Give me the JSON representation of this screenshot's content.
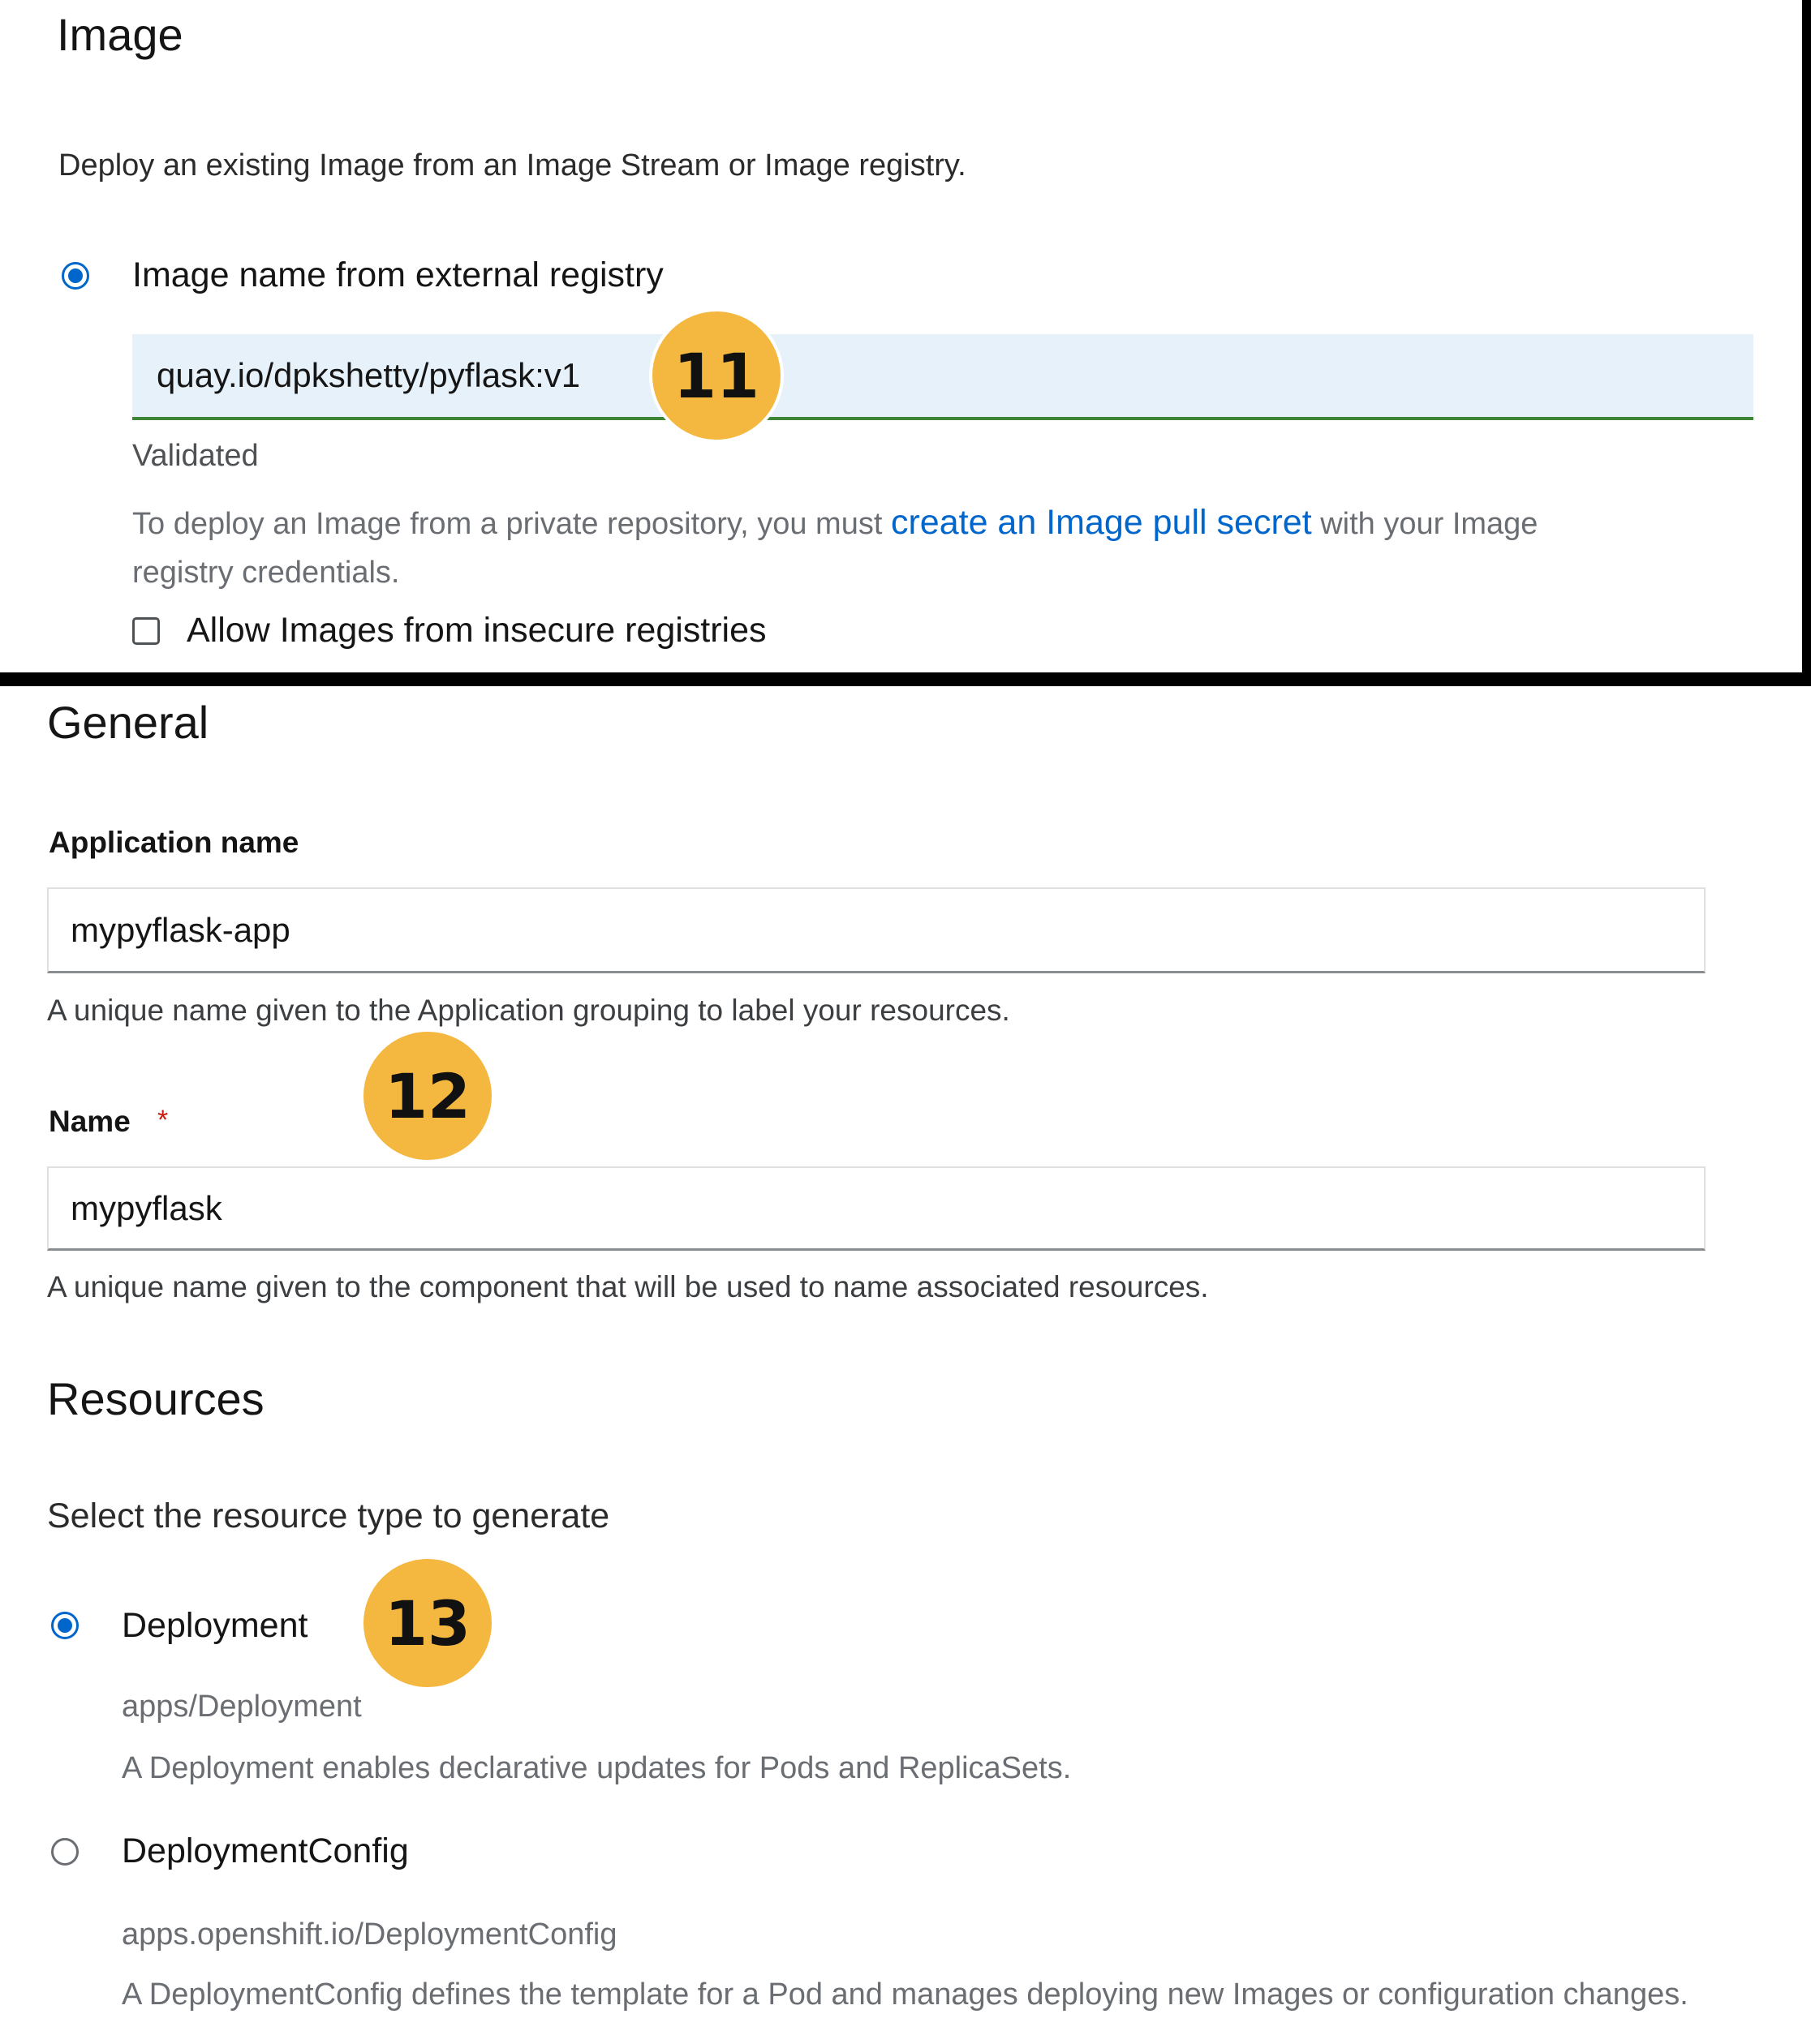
{
  "image_section": {
    "title": "Image",
    "description": "Deploy an existing Image from an Image Stream or Image registry.",
    "option_label": "Image name from external registry",
    "image_value": "quay.io/dpkshetty/pyflask:v1",
    "validated_text": "Validated",
    "private_repo_text_before": "To deploy an Image from a private repository, you must",
    "private_repo_link": "create an Image pull secret",
    "private_repo_text_after": "with your Image",
    "private_repo_text_line2": "registry credentials.",
    "insecure_checkbox_label": "Allow Images from insecure registries"
  },
  "general_section": {
    "title": "General",
    "app_name_label": "Application name",
    "app_name_value": "mypyflask-app",
    "app_name_helper": "A unique name given to the Application grouping to label your resources.",
    "name_label": "Name",
    "name_required_marker": "*",
    "name_value": "mypyflask",
    "name_helper": "A unique name given to the component that will be used to name associated resources."
  },
  "resources_section": {
    "title": "Resources",
    "prompt": "Select the resource type to generate",
    "options": [
      {
        "label": "Deployment",
        "api": "apps/Deployment",
        "description": "A Deployment enables declarative updates for Pods and ReplicaSets.",
        "selected": true
      },
      {
        "label": "DeploymentConfig",
        "api": "apps.openshift.io/DeploymentConfig",
        "description": "A DeploymentConfig defines the template for a Pod and manages deploying new Images or configuration changes.",
        "selected": false
      }
    ]
  },
  "callouts": [
    "11",
    "12",
    "13"
  ],
  "colors": {
    "accent_blue": "#0066cc",
    "validated_green": "#3e8635",
    "callout_yellow": "#f4b73f",
    "input_highlight": "#e7f1fa"
  }
}
